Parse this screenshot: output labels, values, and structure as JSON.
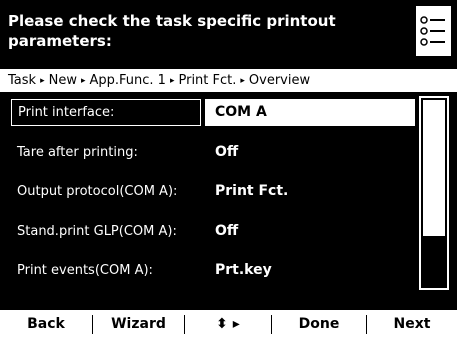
{
  "header": {
    "title": "Please check the task specific printout parameters:",
    "icon": "list-settings-icon"
  },
  "breadcrumb": {
    "items": [
      "Task",
      "New",
      "App.Func. 1",
      "Print Fct.",
      "Overview"
    ],
    "separator": "▸"
  },
  "parameters": [
    {
      "label": "Print interface:",
      "value": "COM A",
      "selected": true
    },
    {
      "label": "Tare after printing:",
      "value": "Off",
      "selected": false
    },
    {
      "label": "Output protocol(COM A):",
      "value": "Print Fct.",
      "selected": false
    },
    {
      "label": "Stand.print GLP(COM A):",
      "value": "Off",
      "selected": false
    },
    {
      "label": "Print events(COM A):",
      "value": "Prt.key",
      "selected": false
    }
  ],
  "softkeys": {
    "back": "Back",
    "wizard": "Wizard",
    "navigate": "⬍ ▸",
    "done": "Done",
    "next": "Next"
  },
  "colors": {
    "background": "#000000",
    "foreground": "#ffffff"
  }
}
